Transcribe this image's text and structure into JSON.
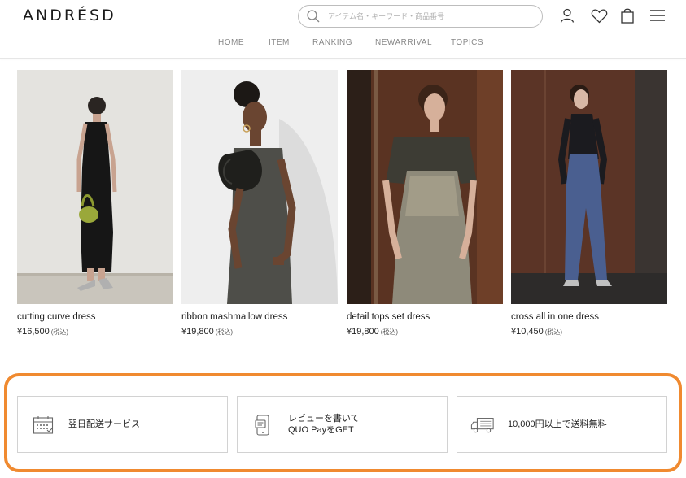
{
  "header": {
    "logo": "ANDRÉSD",
    "search_placeholder": "アイテム名・キーワード・商品番号",
    "icons": [
      "account-icon",
      "heart-icon",
      "bag-icon",
      "menu-icon"
    ]
  },
  "nav": {
    "items": [
      "HOME",
      "ITEM",
      "RANKING",
      "NEWARRIVAL",
      "TOPICS"
    ]
  },
  "products": [
    {
      "name": "cutting curve dress",
      "price": "¥16,500",
      "tax": "(税込)"
    },
    {
      "name": "ribbon mashmallow dress",
      "price": "¥19,800",
      "tax": "(税込)"
    },
    {
      "name": "detail tops set dress",
      "price": "¥19,800",
      "tax": "(税込)"
    },
    {
      "name": "cross all in one dress",
      "price": "¥10,450",
      "tax": "(税込)"
    }
  ],
  "services": [
    {
      "icon": "calendar-icon",
      "line1": "翌日配送サービス",
      "line2": ""
    },
    {
      "icon": "phone-review-icon",
      "line1": "レビューを書いて",
      "line2": "QUO PayをGET"
    },
    {
      "icon": "truck-icon",
      "line1": "10,000円以上で送料無料",
      "line2": ""
    }
  ],
  "colors": {
    "highlight_border": "#f08a30",
    "text": "#222222",
    "nav_text": "#888888"
  }
}
